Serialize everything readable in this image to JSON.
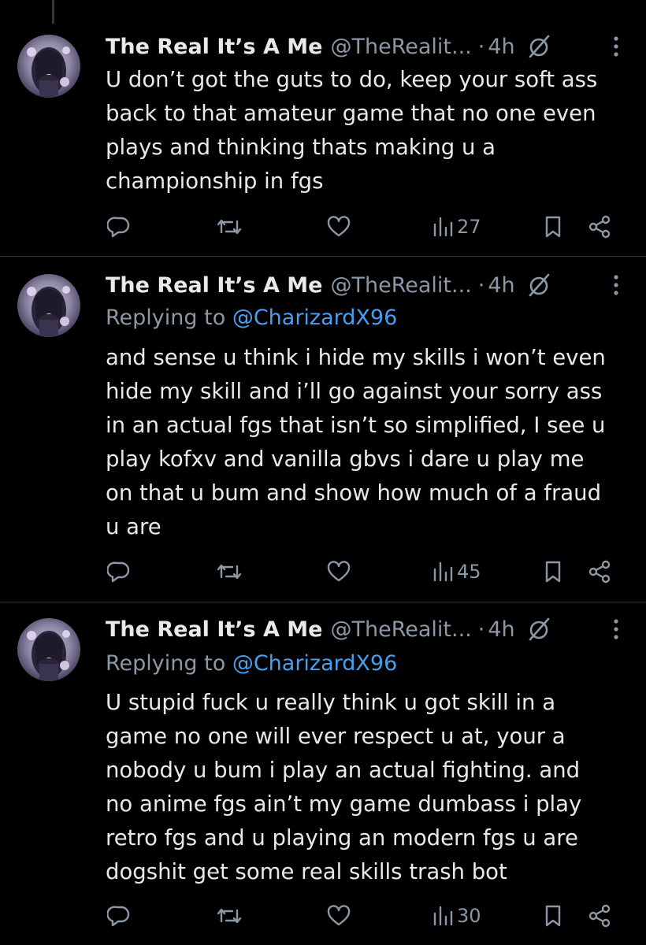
{
  "colors": {
    "background": "#000000",
    "text": "#e7e9ea",
    "secondary": "#8b98a5",
    "mention": "#4a9ef0",
    "divider": "#2f3336"
  },
  "icons": {
    "reply": "reply-icon",
    "repost": "repost-icon",
    "like": "heart-icon",
    "views": "views-icon",
    "bookmark": "bookmark-icon",
    "share": "share-icon",
    "grok": "grok-icon",
    "more": "more-icon"
  },
  "tweets": [
    {
      "name": "The Real It’s A Me",
      "handle": "@TheRealit...",
      "separator": "·",
      "time": "4h",
      "replying_prefix": "",
      "replying_to": "",
      "text": "U don’t got the guts to do, keep your soft ass\nback to that amateur game that no one even\nplays and thinking thats making u a\nchampionship in fgs",
      "views": "27"
    },
    {
      "name": "The Real It’s A Me",
      "handle": "@TheRealit...",
      "separator": "·",
      "time": "4h",
      "replying_prefix": "Replying to",
      "replying_to": "@CharizardX96",
      "text": "and sense u think i hide my skills i won’t even\nhide my skill and i’ll go against your sorry ass\nin an actual fgs that isn’t so simplified, I see u\nplay kofxv and vanilla gbvs i dare u play me\non that u bum and show how much of a fraud\nu are",
      "views": "45"
    },
    {
      "name": "The Real It’s A Me",
      "handle": "@TheRealit...",
      "separator": "·",
      "time": "4h",
      "replying_prefix": "Replying to",
      "replying_to": "@CharizardX96",
      "text": "U stupid fuck u really think u got skill in a\ngame no one will ever respect u at, your a\nnobody u bum i play an actual fighting. and\nno anime fgs ain’t my game dumbass i play\nretro fgs and u playing an modern fgs u are\ndogshit get some real skills trash bot",
      "views": "30"
    }
  ]
}
